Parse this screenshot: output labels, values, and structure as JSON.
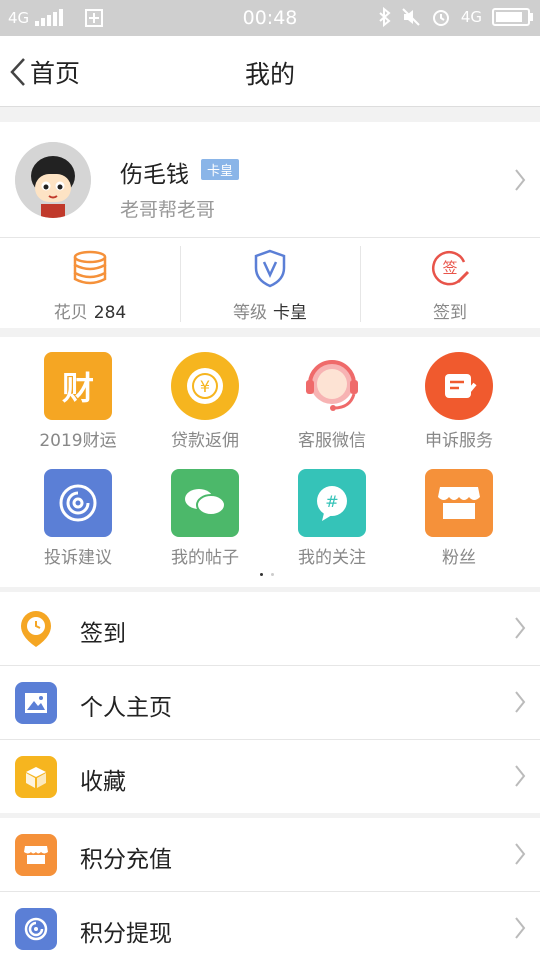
{
  "status": {
    "network_left": "4G",
    "time": "00:48",
    "network_right": "4G"
  },
  "nav": {
    "back_label": "首页",
    "title": "我的"
  },
  "profile": {
    "name": "伤毛钱",
    "badge": "卡皇",
    "subtitle": "老哥帮老哥"
  },
  "stats": [
    {
      "label": "花贝",
      "value": "284",
      "icon": "coin-stack-icon"
    },
    {
      "label": "等级",
      "value": "卡皇",
      "icon": "shield-v-icon"
    },
    {
      "label": "签到",
      "value": "",
      "icon": "sign-in-stamp-icon"
    }
  ],
  "grid": {
    "items": [
      {
        "label": "2019财运",
        "icon": "fortune-icon",
        "glyph": "财",
        "color": "#f5a623"
      },
      {
        "label": "贷款返佣",
        "icon": "coin-yen-icon",
        "glyph": "¥",
        "color": "#f6b51f"
      },
      {
        "label": "客服微信",
        "icon": "customer-service-icon",
        "glyph": "",
        "color": "#ef6a6a"
      },
      {
        "label": "申诉服务",
        "icon": "appeal-icon",
        "glyph": "",
        "color": "#f05a2e"
      },
      {
        "label": "投诉建议",
        "icon": "complaint-icon",
        "glyph": "",
        "color": "#5b7fd6"
      },
      {
        "label": "我的帖子",
        "icon": "chat-bubbles-icon",
        "glyph": "",
        "color": "#4cb86a"
      },
      {
        "label": "我的关注",
        "icon": "hashtag-icon",
        "glyph": "#",
        "color": "#35c3b8"
      },
      {
        "label": "粉丝",
        "icon": "shop-awning-icon",
        "glyph": "",
        "color": "#f5913a"
      }
    ],
    "page_count": 2,
    "current_page": 1
  },
  "menu1": [
    {
      "label": "签到",
      "icon": "location-clock-icon",
      "color": "#f5a623"
    },
    {
      "label": "个人主页",
      "icon": "picture-icon",
      "color": "#5b7fd6"
    },
    {
      "label": "收藏",
      "icon": "box-icon",
      "color": "#f6b51f"
    }
  ],
  "menu2": [
    {
      "label": "积分充值",
      "icon": "shop-awning-icon",
      "color": "#f5913a"
    },
    {
      "label": "积分提现",
      "icon": "swirl-icon",
      "color": "#5b7fd6"
    }
  ]
}
